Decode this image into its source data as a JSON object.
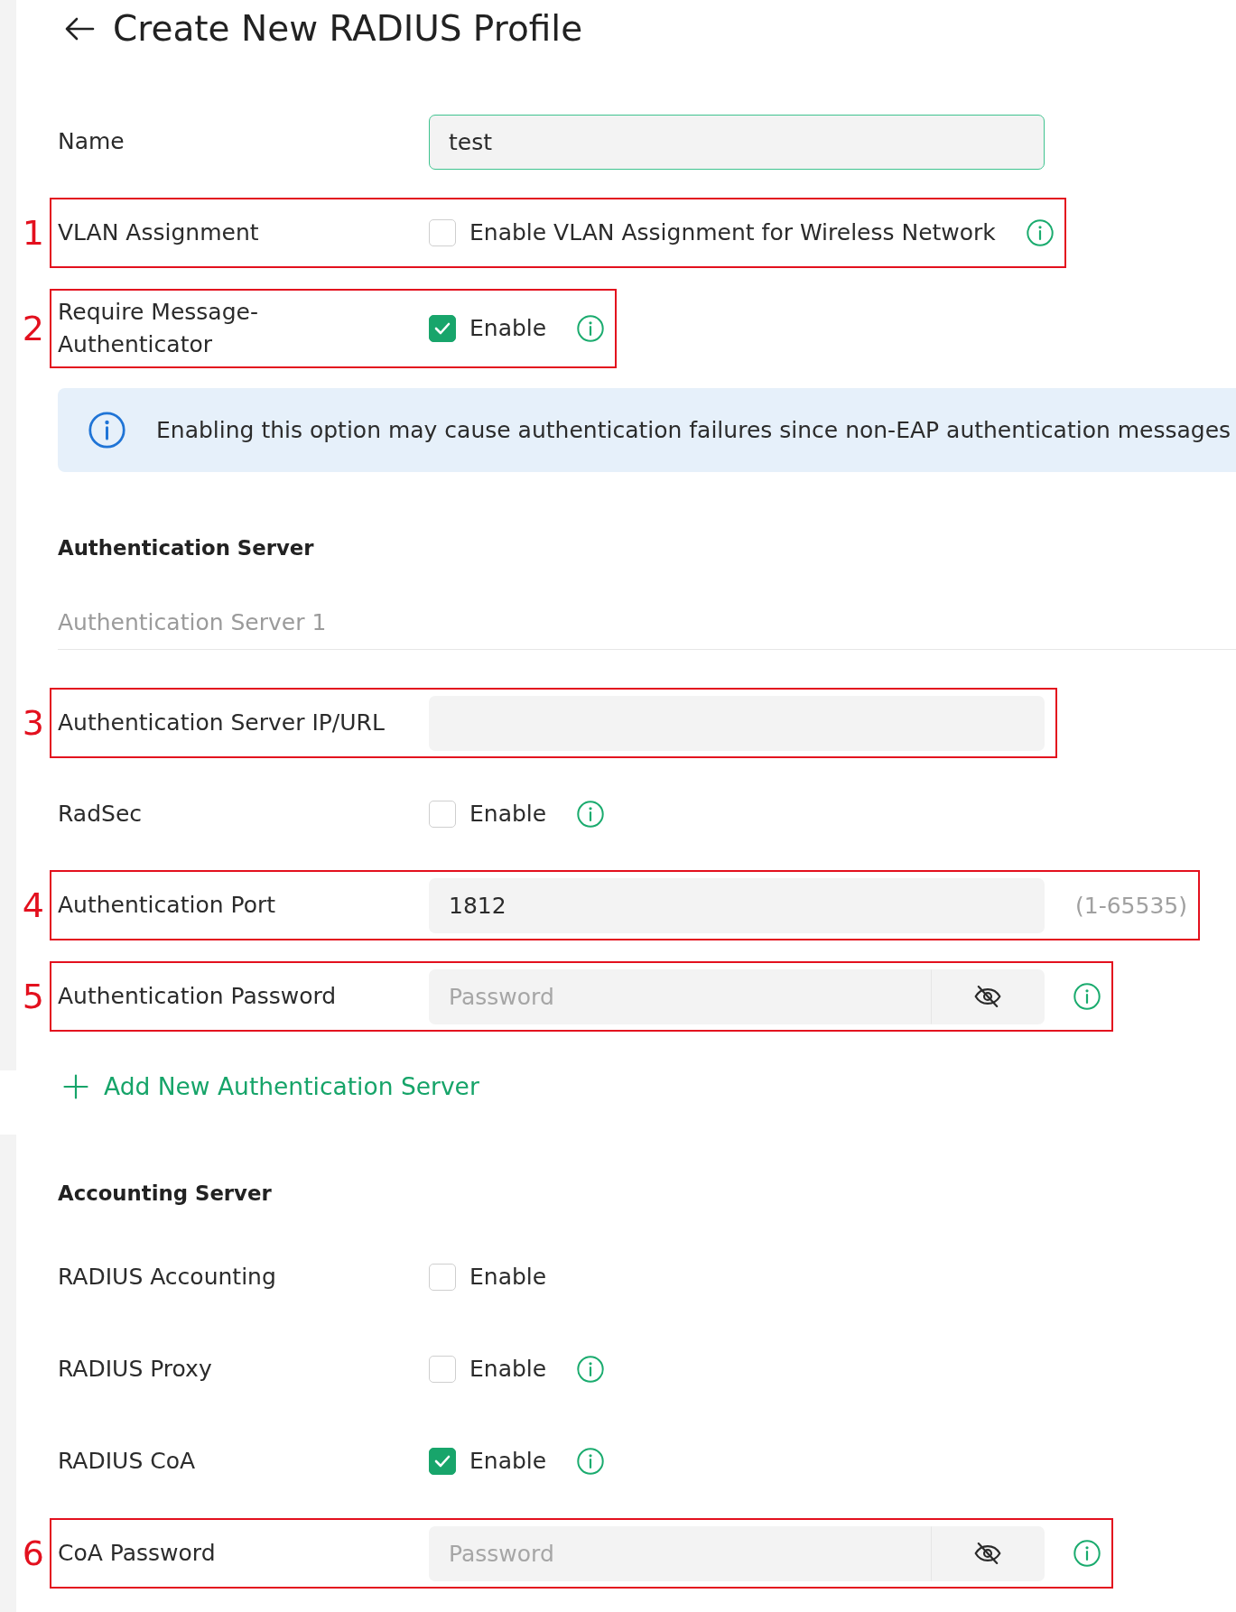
{
  "header": {
    "title": "Create New RADIUS Profile"
  },
  "general": [
    {
      "kind": "text",
      "label": "Name",
      "value": "test",
      "focused": true
    },
    {
      "kind": "checkbox",
      "label": "VLAN Assignment",
      "option": "Enable VLAN Assignment for Wireless Network",
      "checked": false,
      "info": true,
      "annotation": "1"
    },
    {
      "kind": "checkbox",
      "label": "Require Message-Authenticator",
      "option": "Enable",
      "checked": true,
      "info": true,
      "annotation": "2"
    }
  ],
  "notice": {
    "text": "Enabling this option may cause authentication failures since non-EAP authentication messages"
  },
  "authentication": {
    "heading": "Authentication Server",
    "servers": [
      {
        "title": "Authentication Server 1",
        "fields": [
          {
            "kind": "text",
            "label": "Authentication Server IP/URL",
            "focused": false,
            "annotation": "3"
          },
          {
            "kind": "checkbox",
            "label": "RadSec",
            "option": "Enable",
            "checked": false,
            "info": true
          },
          {
            "kind": "text",
            "label": "Authentication Port",
            "value": "1812",
            "hint": "(1-65535)",
            "focused": false,
            "annotation": "4"
          },
          {
            "kind": "password",
            "label": "Authentication Password",
            "placeholder": "Password",
            "focused": false,
            "info": true,
            "annotation": "5"
          }
        ]
      }
    ],
    "add_button": {
      "label": "Add New Authentication Server"
    }
  },
  "accounting": {
    "heading": "Accounting Server",
    "fields": [
      {
        "kind": "checkbox",
        "label": "RADIUS Accounting",
        "option": "Enable",
        "checked": false,
        "info": false
      },
      {
        "kind": "checkbox",
        "label": "RADIUS Proxy",
        "option": "Enable",
        "checked": false,
        "info": true
      },
      {
        "kind": "checkbox",
        "label": "RADIUS CoA",
        "option": "Enable",
        "checked": true,
        "info": true
      },
      {
        "kind": "password",
        "label": "CoA Password",
        "placeholder": "Password",
        "focused": false,
        "info": true,
        "annotation": "6"
      }
    ]
  }
}
